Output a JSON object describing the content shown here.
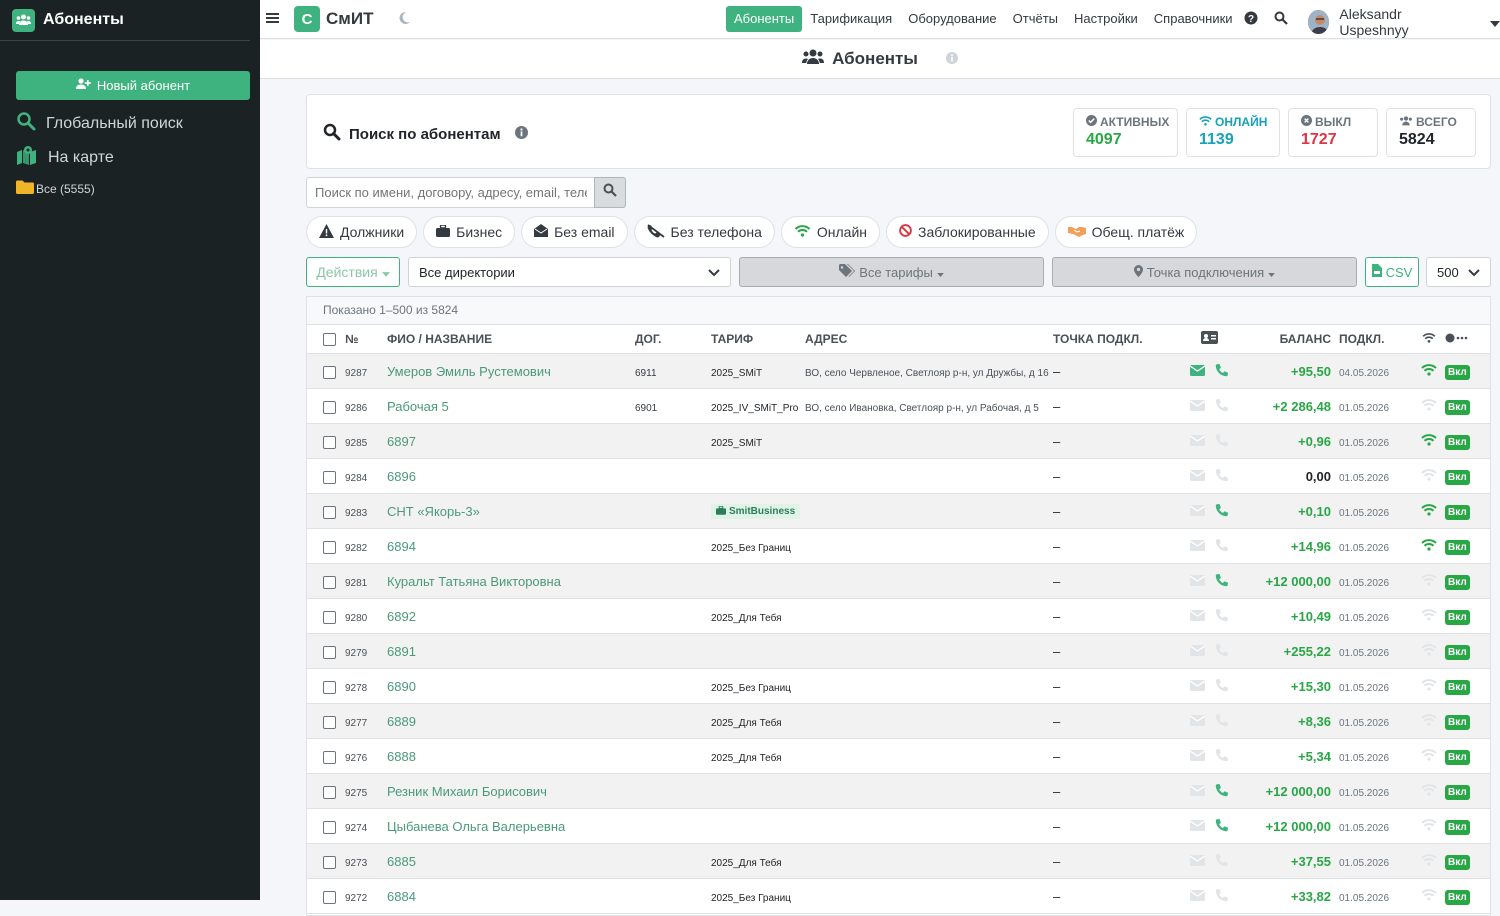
{
  "sidebar": {
    "title": "Абоненты",
    "new_button": "Новый абонент",
    "global_search": "Глобальный поиск",
    "map": "На карте",
    "folder": "Все (5555)"
  },
  "topbar": {
    "logo_letter": "С",
    "logo_name": "СмИТ",
    "nav": [
      {
        "label": "Абоненты",
        "active": true
      },
      {
        "label": "Тарификация"
      },
      {
        "label": "Оборудование"
      },
      {
        "label": "Отчёты"
      },
      {
        "label": "Настройки"
      },
      {
        "label": "Справочники"
      }
    ],
    "user": "Aleksandr Uspeshnyy"
  },
  "page": {
    "title": "Абоненты"
  },
  "search": {
    "title": "Поиск по абонентам",
    "placeholder": "Поиск по имени, договору, адресу, email, телефону"
  },
  "stats": [
    {
      "label": "Активных",
      "value": "4097",
      "color": "#28a745"
    },
    {
      "label": "Онлайн",
      "value": "1139",
      "color": "#17a2b8"
    },
    {
      "label": "Выкл",
      "value": "1727",
      "color": "#dc3545"
    },
    {
      "label": "Всего",
      "value": "5824",
      "color": "#212529"
    }
  ],
  "chips": [
    "Должники",
    "Бизнес",
    "Без email",
    "Без телефона",
    "Онлайн",
    "Заблокированные",
    "Обещ. платёж"
  ],
  "filters": {
    "actions": "Действия",
    "directory": "Все директории",
    "tariffs": "Все тарифы",
    "point": "Точка подключения",
    "csv": "CSV",
    "per_page": "500"
  },
  "table": {
    "shown": "Показано 1–500 из 5824",
    "headers": {
      "num": "№",
      "name": "ФИО / Название",
      "dog": "Дог.",
      "tariff": "Тариф",
      "address": "Адрес",
      "point": "Точка подкл.",
      "balance": "Баланс",
      "connected": "Подкл."
    },
    "rows": [
      {
        "num": "9287",
        "name": "Умеров Эмиль Рустемович",
        "dog": "6911",
        "tariff": "2025_SMiT",
        "address": "ВО, село Червленое, Светлояр р-н, ул Дружбы, д 16",
        "point": "–",
        "email": true,
        "phone": true,
        "balance": "+95,50",
        "date": "04.05.2026",
        "wifi": true,
        "status": "Вкл"
      },
      {
        "num": "9286",
        "name": "Рабочая 5",
        "dog": "6901",
        "tariff": "2025_IV_SMiT_Pro",
        "address": "ВО, село Ивановка, Светлояр р-н, ул Рабочая, д 5",
        "point": "–",
        "email": false,
        "phone": false,
        "balance": "+2 286,48",
        "date": "01.05.2026",
        "wifi": false,
        "status": "Вкл"
      },
      {
        "num": "9285",
        "name": "6897",
        "dog": "",
        "tariff": "2025_SMiT",
        "address": "",
        "point": "–",
        "email": false,
        "phone": false,
        "balance": "+0,96",
        "date": "01.05.2026",
        "wifi": true,
        "status": "Вкл"
      },
      {
        "num": "9284",
        "name": "6896",
        "dog": "",
        "tariff": "",
        "address": "",
        "point": "–",
        "email": false,
        "phone": false,
        "balance": "0,00",
        "date": "01.05.2026",
        "wifi": false,
        "status": "Вкл"
      },
      {
        "num": "9283",
        "name": "СНТ «Якорь-3»",
        "dog": "",
        "tariff": "SmitBusiness",
        "biz": true,
        "address": "",
        "point": "–",
        "email": false,
        "phone": true,
        "balance": "+0,10",
        "date": "01.05.2026",
        "wifi": true,
        "status": "Вкл"
      },
      {
        "num": "9282",
        "name": "6894",
        "dog": "",
        "tariff": "2025_Без Границ",
        "address": "",
        "point": "–",
        "email": false,
        "phone": false,
        "balance": "+14,96",
        "date": "01.05.2026",
        "wifi": true,
        "status": "Вкл"
      },
      {
        "num": "9281",
        "name": "Куральт Татьяна Викторовна",
        "dog": "",
        "tariff": "",
        "address": "",
        "point": "–",
        "email": false,
        "phone": true,
        "balance": "+12 000,00",
        "date": "01.05.2026",
        "wifi": false,
        "status": "Вкл"
      },
      {
        "num": "9280",
        "name": "6892",
        "dog": "",
        "tariff": "2025_Для Тебя",
        "address": "",
        "point": "–",
        "email": false,
        "phone": false,
        "balance": "+10,49",
        "date": "01.05.2026",
        "wifi": false,
        "status": "Вкл"
      },
      {
        "num": "9279",
        "name": "6891",
        "dog": "",
        "tariff": "",
        "address": "",
        "point": "–",
        "email": false,
        "phone": false,
        "balance": "+255,22",
        "date": "01.05.2026",
        "wifi": false,
        "status": "Вкл"
      },
      {
        "num": "9278",
        "name": "6890",
        "dog": "",
        "tariff": "2025_Без Границ",
        "address": "",
        "point": "–",
        "email": false,
        "phone": false,
        "balance": "+15,30",
        "date": "01.05.2026",
        "wifi": false,
        "status": "Вкл"
      },
      {
        "num": "9277",
        "name": "6889",
        "dog": "",
        "tariff": "2025_Для Тебя",
        "address": "",
        "point": "–",
        "email": false,
        "phone": false,
        "balance": "+8,36",
        "date": "01.05.2026",
        "wifi": false,
        "status": "Вкл"
      },
      {
        "num": "9276",
        "name": "6888",
        "dog": "",
        "tariff": "2025_Для Тебя",
        "address": "",
        "point": "–",
        "email": false,
        "phone": false,
        "balance": "+5,34",
        "date": "01.05.2026",
        "wifi": false,
        "status": "Вкл"
      },
      {
        "num": "9275",
        "name": "Резник Михаил Борисович",
        "dog": "",
        "tariff": "",
        "address": "",
        "point": "–",
        "email": false,
        "phone": true,
        "balance": "+12 000,00",
        "date": "01.05.2026",
        "wifi": false,
        "status": "Вкл"
      },
      {
        "num": "9274",
        "name": "Цыбанева Ольга Валерьевна",
        "dog": "",
        "tariff": "",
        "address": "",
        "point": "–",
        "email": false,
        "phone": true,
        "balance": "+12 000,00",
        "date": "01.05.2026",
        "wifi": false,
        "status": "Вкл"
      },
      {
        "num": "9273",
        "name": "6885",
        "dog": "",
        "tariff": "2025_Для Тебя",
        "address": "",
        "point": "–",
        "email": false,
        "phone": false,
        "balance": "+37,55",
        "date": "01.05.2026",
        "wifi": false,
        "status": "Вкл"
      },
      {
        "num": "9272",
        "name": "6884",
        "dog": "",
        "tariff": "2025_Без Границ",
        "address": "",
        "point": "–",
        "email": false,
        "phone": false,
        "balance": "+33,82",
        "date": "01.05.2026",
        "wifi": false,
        "status": "Вкл"
      }
    ]
  }
}
